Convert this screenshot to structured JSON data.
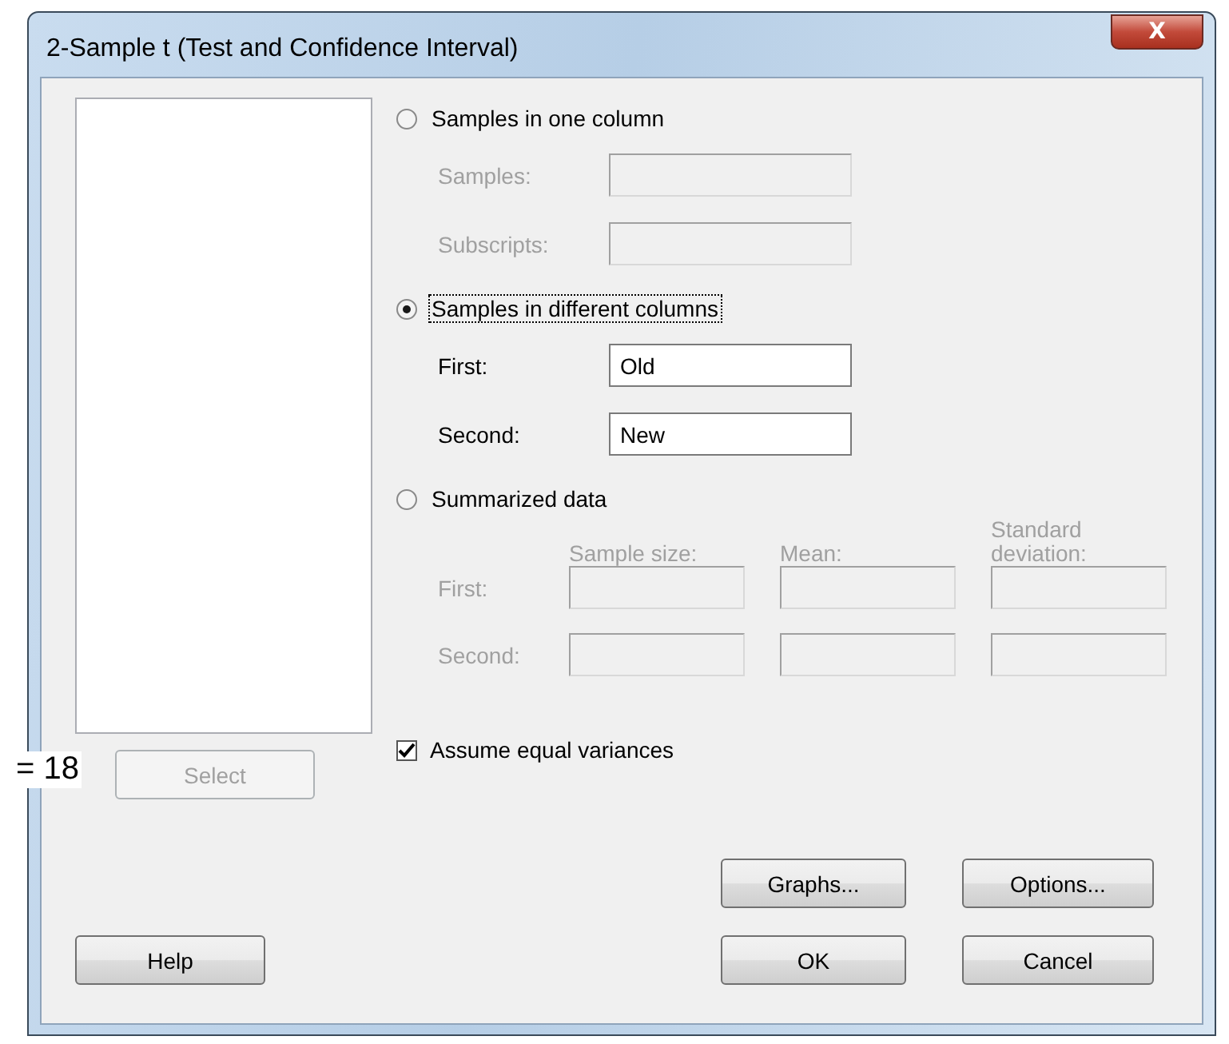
{
  "window": {
    "title": "2-Sample t (Test and Confidence Interval)",
    "close_glyph": "X"
  },
  "side_text": "= 18",
  "select_button": {
    "label": "Select",
    "disabled": true
  },
  "options": [
    {
      "kind": "columns",
      "label": "Samples in one column",
      "selected": false,
      "fields": [
        {
          "label": "Samples:",
          "disabled": true
        },
        {
          "label": "Subscripts:",
          "disabled": true
        }
      ]
    },
    {
      "kind": "columns",
      "label": "Samples in different columns",
      "selected": true,
      "fields": [
        {
          "label": "First:",
          "value": "Old",
          "disabled": false
        },
        {
          "label": "Second:",
          "value": "New",
          "disabled": false
        }
      ]
    },
    {
      "kind": "summary",
      "label": "Summarized data",
      "selected": false,
      "disabled": true,
      "headers": [
        "Sample size:",
        "Mean:",
        "Standard deviation:"
      ],
      "rows": [
        {
          "label": "First:"
        },
        {
          "label": "Second:"
        }
      ]
    }
  ],
  "equal_variances": {
    "label": "Assume equal variances",
    "checked": true
  },
  "buttons": [
    {
      "label": "Graphs..."
    },
    {
      "label": "Options..."
    },
    {
      "label": "Help"
    },
    {
      "label": "OK"
    },
    {
      "label": "Cancel"
    }
  ]
}
